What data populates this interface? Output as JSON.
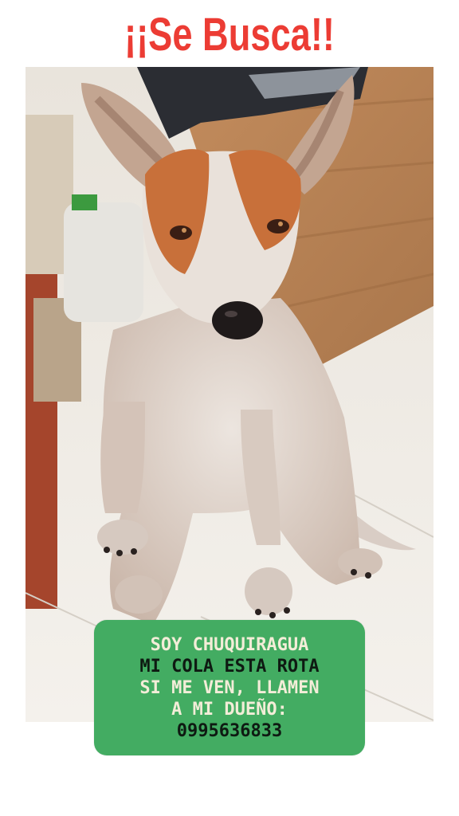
{
  "poster": {
    "title": "¡¡Se Busca!!",
    "accent_color": "#ec3c34",
    "box_color": "#43ac62",
    "photo": {
      "subject": "dog-photo"
    },
    "message_lines": [
      "SOY CHUQUIRAGUA",
      "MI COLA ESTA ROTA",
      "SI ME VEN, LLAMEN",
      "A MI DUEÑO:",
      "0995636833"
    ]
  }
}
